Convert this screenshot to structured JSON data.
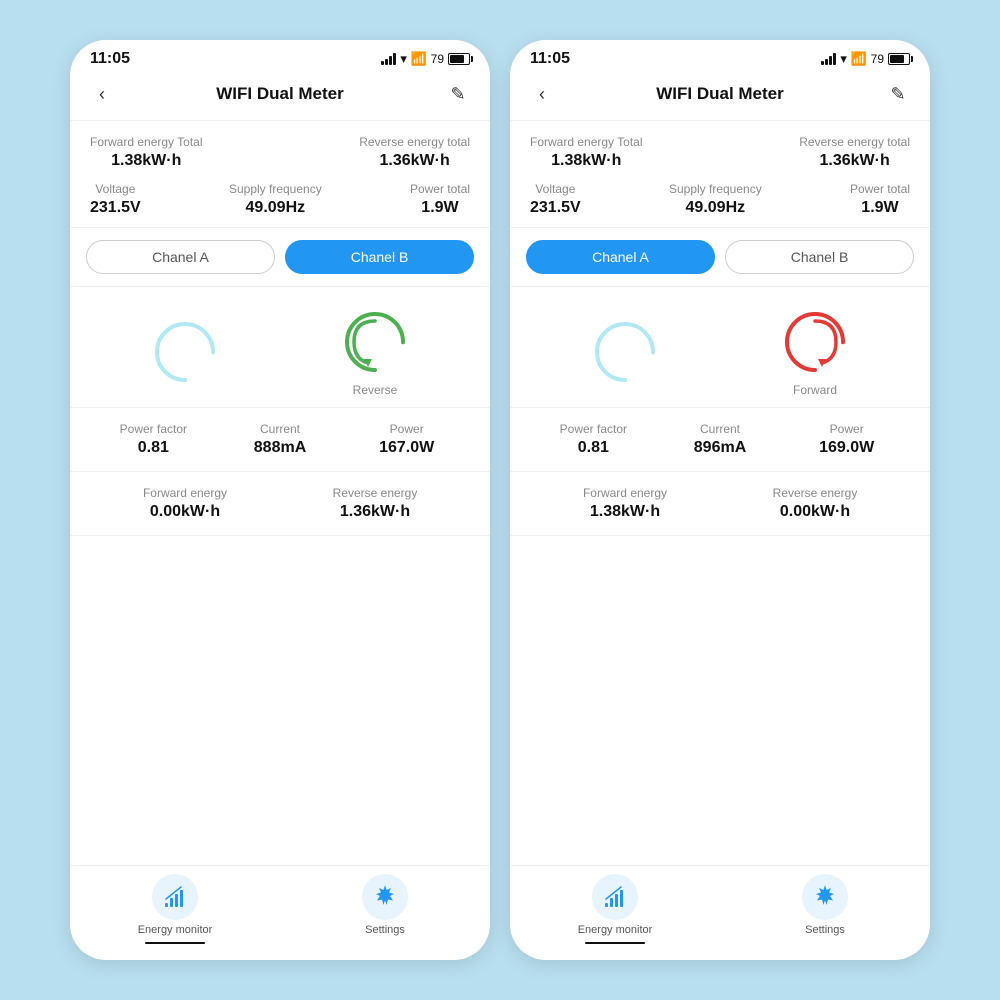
{
  "phones": [
    {
      "id": "phone-b",
      "time": "11:05",
      "battery": "79",
      "title": "WIFI Dual Meter",
      "forward_energy_total_label": "Forward energy Total",
      "forward_energy_total_value": "1.38kW·h",
      "reverse_energy_total_label": "Reverse energy total",
      "reverse_energy_total_value": "1.36kW·h",
      "voltage_label": "Voltage",
      "voltage_value": "231.5V",
      "freq_label": "Supply frequency",
      "freq_value": "49.09Hz",
      "power_total_label": "Power total",
      "power_total_value": "1.9W",
      "channel_a_label": "Chanel A",
      "channel_b_label": "Chanel B",
      "active_channel": "B",
      "gauge_direction_label": "Reverse",
      "gauge_color": "#4CAF50",
      "power_factor_label": "Power factor",
      "power_factor_value": "0.81",
      "current_label": "Current",
      "current_value": "888mA",
      "power_label": "Power",
      "power_value": "167.0W",
      "forward_energy_label": "Forward energy",
      "forward_energy_value": "0.00kW·h",
      "reverse_energy_label": "Reverse energy",
      "reverse_energy_value": "1.36kW·h",
      "energy_monitor_label": "Energy monitor",
      "settings_label": "Settings"
    },
    {
      "id": "phone-a",
      "time": "11:05",
      "battery": "79",
      "title": "WIFI Dual Meter",
      "forward_energy_total_label": "Forward energy Total",
      "forward_energy_total_value": "1.38kW·h",
      "reverse_energy_total_label": "Reverse energy total",
      "reverse_energy_total_value": "1.36kW·h",
      "voltage_label": "Voltage",
      "voltage_value": "231.5V",
      "freq_label": "Supply frequency",
      "freq_value": "49.09Hz",
      "power_total_label": "Power total",
      "power_total_value": "1.9W",
      "channel_a_label": "Chanel A",
      "channel_b_label": "Chanel B",
      "active_channel": "A",
      "gauge_direction_label": "Forward",
      "gauge_color": "#e53935",
      "power_factor_label": "Power factor",
      "power_factor_value": "0.81",
      "current_label": "Current",
      "current_value": "896mA",
      "power_label": "Power",
      "power_value": "169.0W",
      "forward_energy_label": "Forward energy",
      "forward_energy_value": "1.38kW·h",
      "reverse_energy_label": "Reverse energy",
      "reverse_energy_value": "0.00kW·h",
      "energy_monitor_label": "Energy monitor",
      "settings_label": "Settings"
    }
  ]
}
